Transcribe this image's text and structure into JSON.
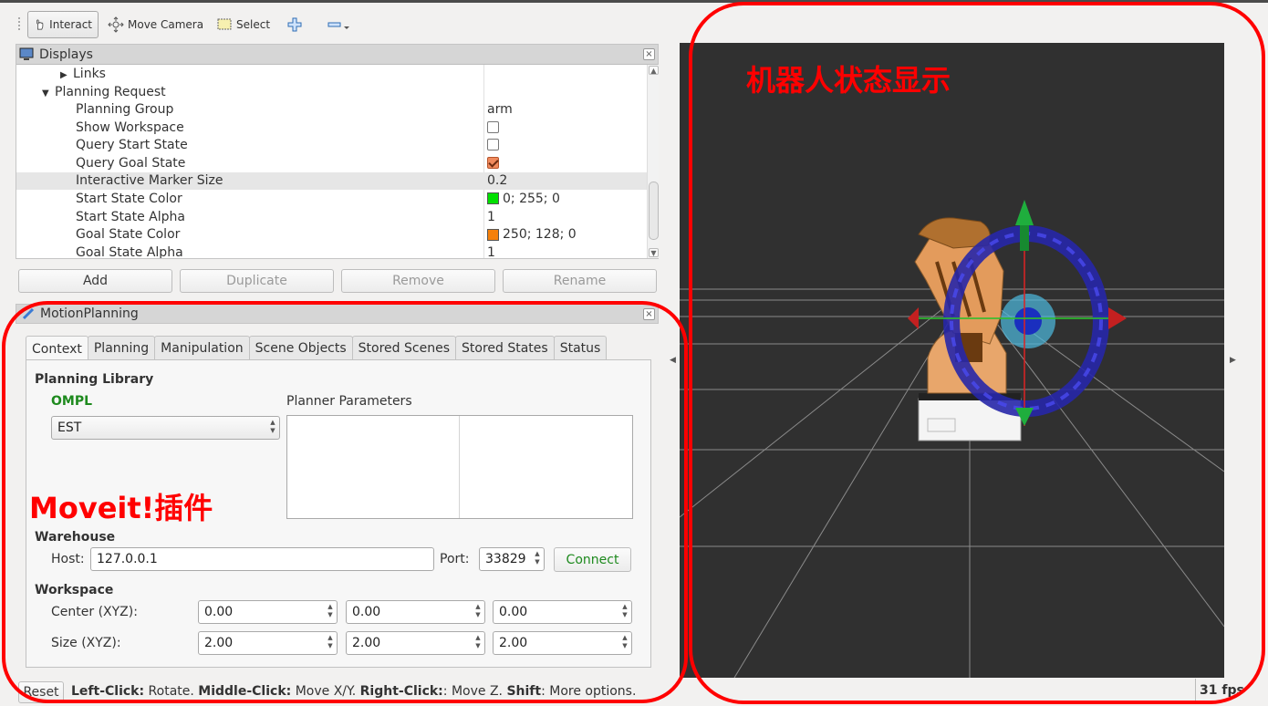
{
  "toolbar": {
    "interact": "Interact",
    "move_camera": "Move Camera",
    "select": "Select"
  },
  "displays": {
    "title": "Displays",
    "close": "×",
    "rows": [
      {
        "name": "Links",
        "value": ""
      },
      {
        "name": "Planning Request",
        "value": ""
      },
      {
        "name": "Planning Group",
        "value": "arm"
      },
      {
        "name": "Show Workspace",
        "value": ""
      },
      {
        "name": "Query Start State",
        "value": ""
      },
      {
        "name": "Query Goal State",
        "value": ""
      },
      {
        "name": "Interactive Marker Size",
        "value": "0.2"
      },
      {
        "name": "Start State Color",
        "value": "0; 255; 0"
      },
      {
        "name": "Start State Alpha",
        "value": "1"
      },
      {
        "name": "Goal State Color",
        "value": "250; 128; 0"
      },
      {
        "name": "Goal State Alpha",
        "value": "1"
      }
    ],
    "start_color": "#00e000",
    "goal_color": "#f5800a",
    "show_workspace_checked": false,
    "query_start_checked": false,
    "query_goal_checked": true
  },
  "display_buttons": {
    "add": "Add",
    "duplicate": "Duplicate",
    "remove": "Remove",
    "rename": "Rename"
  },
  "motion_planning": {
    "title": "MotionPlanning",
    "close": "×",
    "tabs": [
      "Context",
      "Planning",
      "Manipulation",
      "Scene Objects",
      "Stored Scenes",
      "Stored States",
      "Status"
    ],
    "active_tab": "Context",
    "planning_library_label": "Planning Library",
    "library_name": "OMPL",
    "planner_parameters_label": "Planner Parameters",
    "planner_select": "EST",
    "warehouse_label": "Warehouse",
    "host_label": "Host:",
    "host_value": "127.0.0.1",
    "port_label": "Port:",
    "port_value": "33829",
    "connect": "Connect",
    "workspace_label": "Workspace",
    "center_label": "Center (XYZ):",
    "size_label": "Size (XYZ):",
    "center": [
      "0.00",
      "0.00",
      "0.00"
    ],
    "size": [
      "2.00",
      "2.00",
      "2.00"
    ]
  },
  "annotations": {
    "view_label": "机器人状态显示",
    "plugin_label": "Moveit!插件",
    "color": "#ff0000"
  },
  "status": {
    "reset": "Reset",
    "help_parts": [
      {
        "b": "Left-Click:",
        "t": " Rotate. "
      },
      {
        "b": "Middle-Click:",
        "t": " Move X/Y. "
      },
      {
        "b": "Right-Click:",
        "t": ": Move Z. "
      },
      {
        "b": "Shift",
        "t": ": More options."
      }
    ],
    "fps": "31 fps"
  }
}
